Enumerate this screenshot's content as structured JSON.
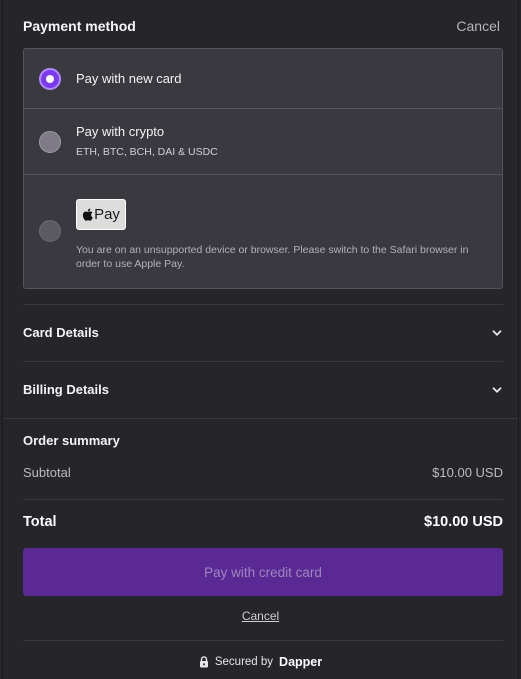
{
  "header": {
    "title": "Payment method",
    "cancel_label": "Cancel"
  },
  "methods": [
    {
      "label": "Pay with new card",
      "state": "selected"
    },
    {
      "label": "Pay with crypto",
      "sub": "ETH, BTC, BCH, DAI & USDC",
      "state": "unselected"
    },
    {
      "applepay_label": "Pay",
      "note": "You are on an unsupported device or browser. Please switch to the Safari browser in order to use Apple Pay.",
      "state": "disabled"
    }
  ],
  "sections": {
    "card_details": "Card Details",
    "billing_details": "Billing Details"
  },
  "summary": {
    "title": "Order summary",
    "subtotal_label": "Subtotal",
    "subtotal_value": "$10.00 USD",
    "total_label": "Total",
    "total_value": "$10.00 USD"
  },
  "actions": {
    "pay_button": "Pay with credit card",
    "cancel_label": "Cancel"
  },
  "footer": {
    "secured_by": "Secured by",
    "brand": "Dapper"
  },
  "colors": {
    "accent": "#7c3aed",
    "pay_button_bg": "#5b2994",
    "background": "#262529",
    "panel": "#3a3940"
  },
  "icons": {
    "select": "chevron-down-icon",
    "apple": "apple-logo-icon",
    "lock": "lock-icon"
  }
}
